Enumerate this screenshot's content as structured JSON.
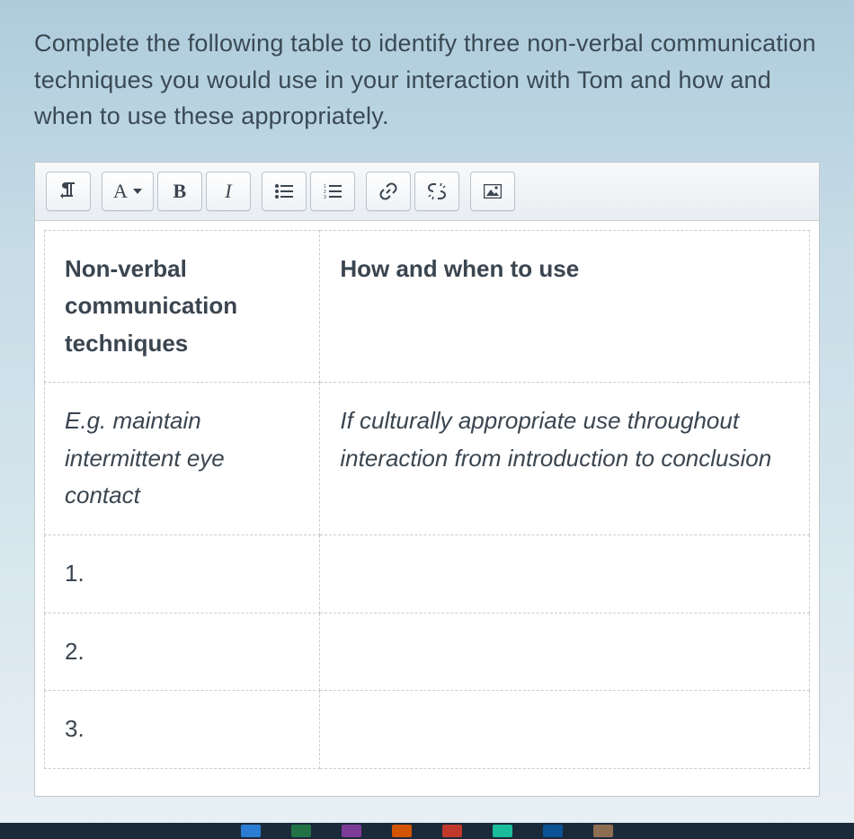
{
  "question": "Complete the following table to identify three non-verbal communication techniques you would use in your interaction with Tom and how and when to use these appropriately.",
  "toolbar": {
    "font_label": "A",
    "bold_label": "B",
    "italic_label": "I"
  },
  "table": {
    "header": {
      "col1": "Non-verbal communication techniques",
      "col2": "How and when to use"
    },
    "example": {
      "col1": "E.g. maintain intermittent eye contact",
      "col2": "If culturally appropriate use throughout interaction from introduction to conclusion"
    },
    "rows": {
      "r1": "1.",
      "r2": "2.",
      "r3": "3."
    }
  }
}
